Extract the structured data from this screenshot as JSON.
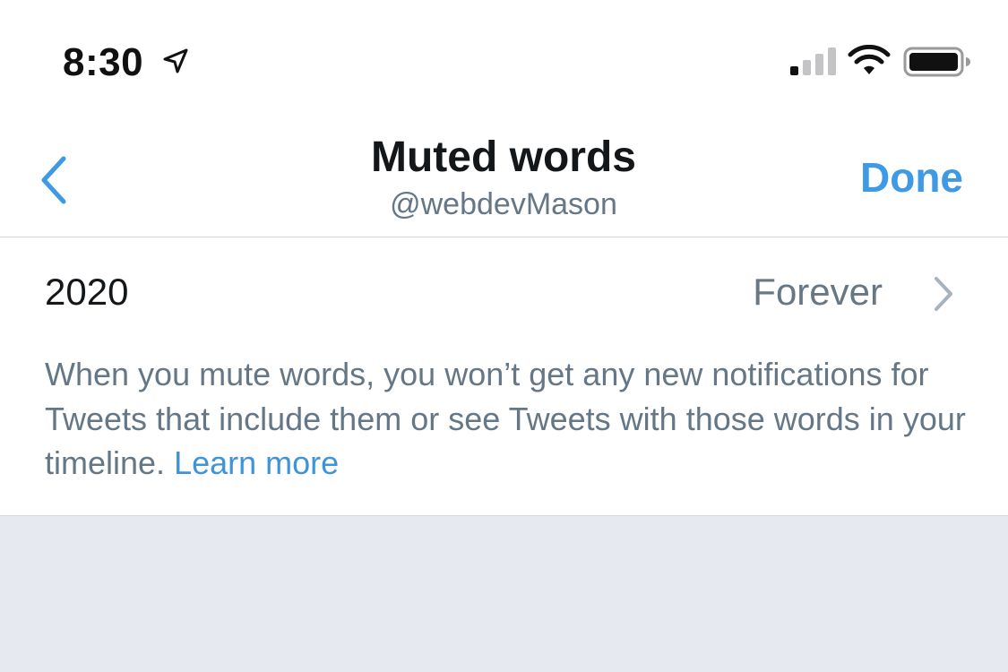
{
  "status_bar": {
    "time": "8:30",
    "icons": [
      "location-arrow-icon",
      "cellular-signal-icon",
      "wifi-icon",
      "battery-icon"
    ]
  },
  "header": {
    "back_icon": "chevron-left-icon",
    "title": "Muted words",
    "subtitle": "@webdevMason",
    "done_label": "Done"
  },
  "muted_word": {
    "word": "2020",
    "duration": "Forever",
    "chevron_icon": "chevron-right-icon"
  },
  "description": {
    "text": "When you mute words, you won’t get any new notifications for Tweets that include them or see Tweets with those words in your timeline.",
    "link_label": "Learn more"
  },
  "colors": {
    "accent": "#3f9ae6",
    "secondary_text": "#657786",
    "primary_text": "#14171a",
    "background": "#e6e9ef"
  }
}
